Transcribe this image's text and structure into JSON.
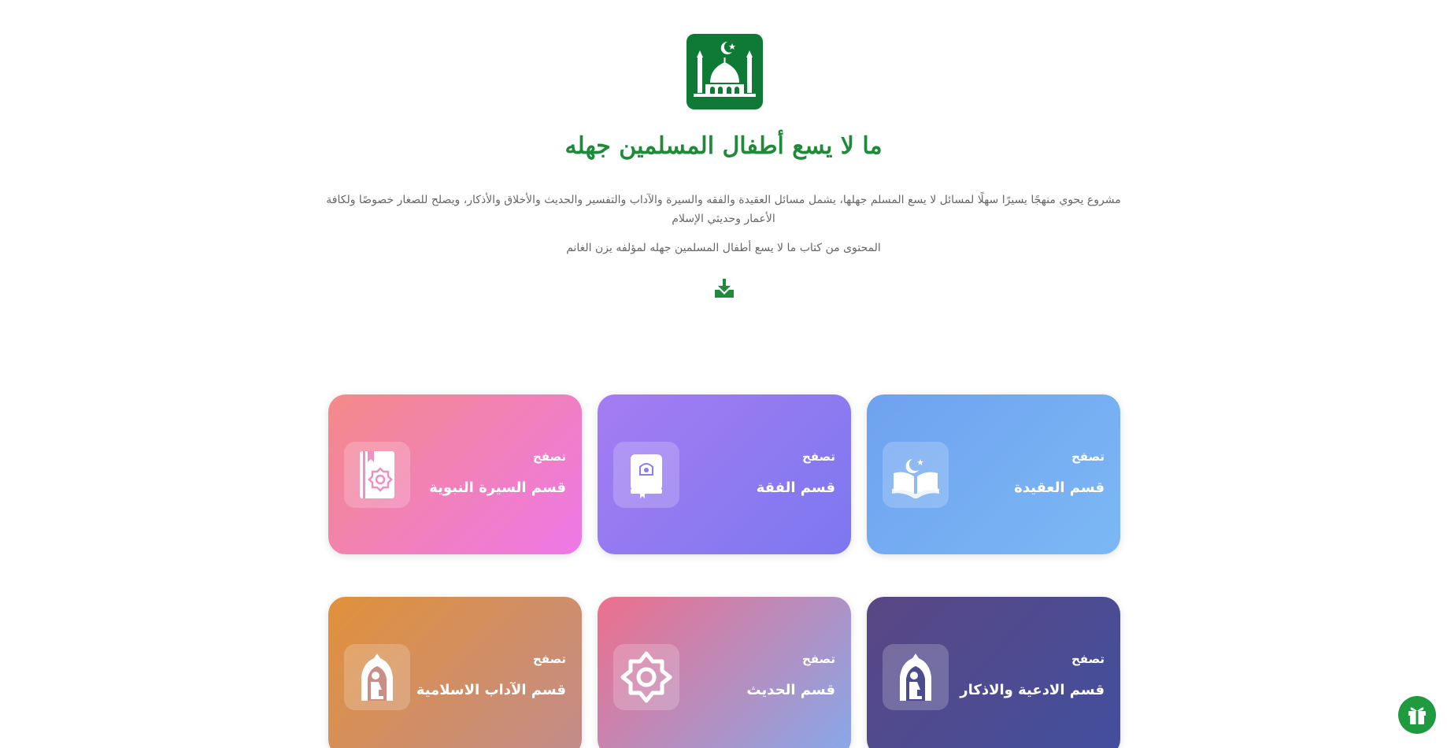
{
  "header": {
    "logo_icon": "mosque-icon",
    "title": "ما لا يسع أطفال المسلمين جهله",
    "description": "مشروع يحوي منهجًا يسيرًا سهلًا لمسائل لا يسع المسلم جهلها، يشمل مسائل العقيدة والفقه والسيرة والآداب والتفسير والحديث والأخلاق والأذكار، ويصلح للصغار خصوصًا ولكافة الأعمار وحديثي الإسلام",
    "source": "المحتوى من كتاب ما لا يسع أطفال المسلمين جهله لمؤلفه يزن الغانم",
    "download_icon": "download-icon",
    "brand_color": "#1f8a3a"
  },
  "cards": [
    {
      "browse": "تصفح",
      "label": "قسم العقيدة",
      "icon": "open-book-crescent-icon"
    },
    {
      "browse": "تصفح",
      "label": "قسم الفقة",
      "icon": "quran-book-icon"
    },
    {
      "browse": "تصفح",
      "label": "قسم السيرة النبوية",
      "icon": "book-bookmark-icon"
    },
    {
      "browse": "تصفح",
      "label": "قسم الادعية والاذكار",
      "icon": "praying-person-icon"
    },
    {
      "browse": "تصفح",
      "label": "قسم الحديث",
      "icon": "islamic-star-icon"
    },
    {
      "browse": "تصفح",
      "label": "قسم الآداب الاسلامية",
      "icon": "praying-person-icon"
    }
  ],
  "floating": {
    "gift_icon": "gift-icon"
  }
}
